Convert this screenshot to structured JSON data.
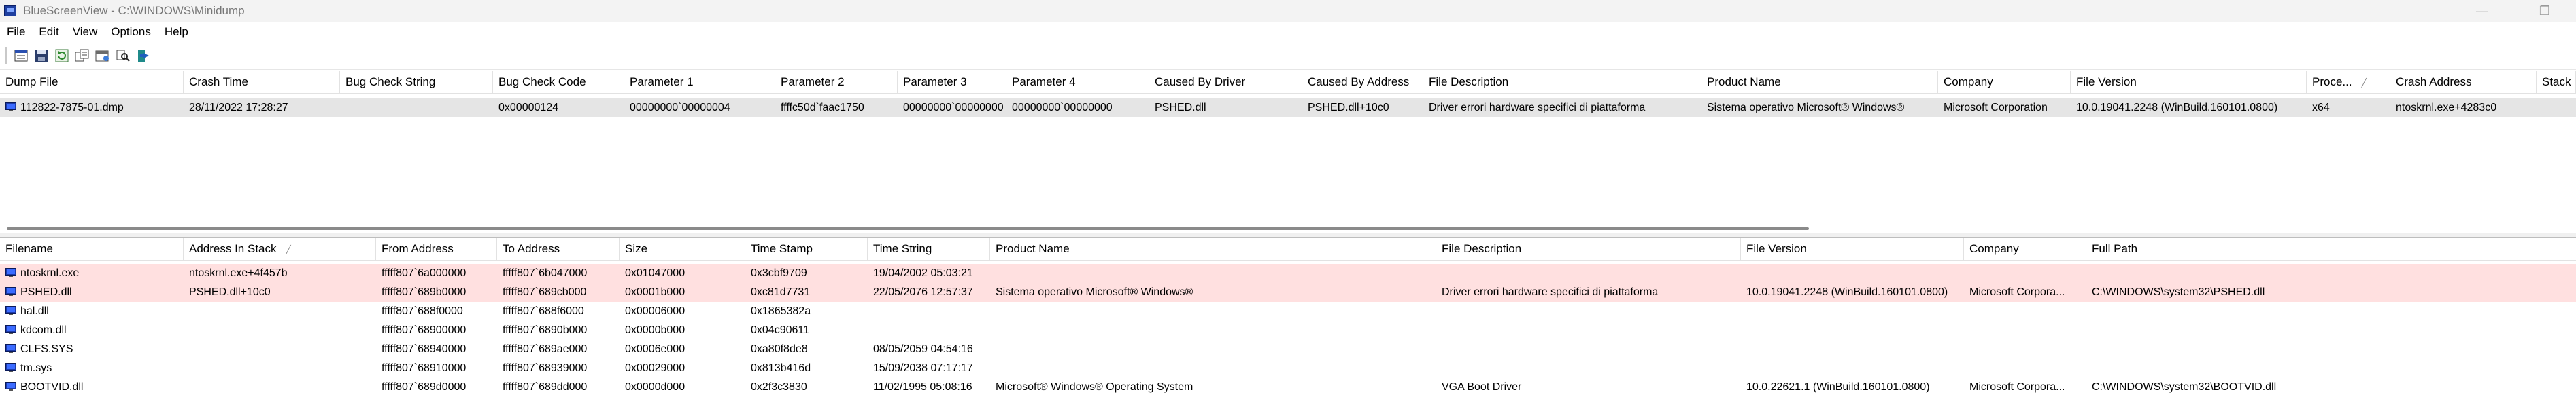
{
  "window": {
    "title": "BlueScreenView - C:\\WINDOWS\\Minidump",
    "controls": [
      "—",
      "❐"
    ]
  },
  "menu": [
    "File",
    "Edit",
    "View",
    "Options",
    "Help"
  ],
  "toolbar": {
    "icons": [
      "properties-icon",
      "save-icon",
      "refresh-icon",
      "copy-icon",
      "html-report-icon",
      "find-icon",
      "exit-icon"
    ]
  },
  "top_table": {
    "columns": [
      {
        "label": "Dump File"
      },
      {
        "label": "Crash Time"
      },
      {
        "label": "Bug Check String"
      },
      {
        "label": "Bug Check Code"
      },
      {
        "label": "Parameter 1"
      },
      {
        "label": "Parameter 2"
      },
      {
        "label": "Parameter 3"
      },
      {
        "label": "Parameter 4"
      },
      {
        "label": "Caused By Driver"
      },
      {
        "label": "Caused By Address"
      },
      {
        "label": "File Description"
      },
      {
        "label": "Product Name"
      },
      {
        "label": "Company"
      },
      {
        "label": "File Version"
      },
      {
        "label": "Proce...",
        "sorted": true
      },
      {
        "label": "Crash Address"
      },
      {
        "label": "Stack"
      }
    ],
    "rows": [
      {
        "cells": [
          "112822-7875-01.dmp",
          "28/11/2022 17:28:27",
          "",
          "0x00000124",
          "00000000`00000004",
          "ffffc50d`faac1750",
          "00000000`00000000",
          "00000000`00000000",
          "PSHED.dll",
          "PSHED.dll+10c0",
          "Driver errori hardware specifici di piattaforma",
          "Sistema operativo Microsoft® Windows®",
          "Microsoft Corporation",
          "10.0.19041.2248 (WinBuild.160101.0800)",
          "x64",
          "ntoskrnl.exe+4283c0",
          ""
        ]
      }
    ]
  },
  "bottom_table": {
    "columns": [
      {
        "label": "Filename"
      },
      {
        "label": "Address In Stack",
        "sorted": true
      },
      {
        "label": "From Address"
      },
      {
        "label": "To Address"
      },
      {
        "label": "Size"
      },
      {
        "label": "Time Stamp"
      },
      {
        "label": "Time String"
      },
      {
        "label": "Product Name"
      },
      {
        "label": "File Description"
      },
      {
        "label": "File Version"
      },
      {
        "label": "Company"
      },
      {
        "label": "Full Path"
      }
    ],
    "rows": [
      {
        "highlight": true,
        "cells": [
          "ntoskrnl.exe",
          "ntoskrnl.exe+4f457b",
          "fffff807`6a000000",
          "fffff807`6b047000",
          "0x01047000",
          "0x3cbf9709",
          "19/04/2002 05:03:21",
          "",
          "",
          "",
          "",
          ""
        ]
      },
      {
        "highlight": true,
        "cells": [
          "PSHED.dll",
          "PSHED.dll+10c0",
          "fffff807`689b0000",
          "fffff807`689cb000",
          "0x0001b000",
          "0xc81d7731",
          "22/05/2076 12:57:37",
          "Sistema operativo Microsoft® Windows®",
          "Driver errori hardware specifici di piattaforma",
          "10.0.19041.2248 (WinBuild.160101.0800)",
          "Microsoft Corpora...",
          "C:\\WINDOWS\\system32\\PSHED.dll"
        ]
      },
      {
        "highlight": false,
        "cells": [
          "hal.dll",
          "",
          "fffff807`688f0000",
          "fffff807`688f6000",
          "0x00006000",
          "0x1865382a",
          "",
          "",
          "",
          "",
          "",
          ""
        ]
      },
      {
        "highlight": false,
        "cells": [
          "kdcom.dll",
          "",
          "fffff807`68900000",
          "fffff807`6890b000",
          "0x0000b000",
          "0x04c90611",
          "",
          "",
          "",
          "",
          "",
          ""
        ]
      },
      {
        "highlight": false,
        "cells": [
          "CLFS.SYS",
          "",
          "fffff807`68940000",
          "fffff807`689ae000",
          "0x0006e000",
          "0xa80f8de8",
          "08/05/2059 04:54:16",
          "",
          "",
          "",
          "",
          ""
        ]
      },
      {
        "highlight": false,
        "cells": [
          "tm.sys",
          "",
          "fffff807`68910000",
          "fffff807`68939000",
          "0x00029000",
          "0x813b416d",
          "15/09/2038 07:17:17",
          "",
          "",
          "",
          "",
          ""
        ]
      },
      {
        "highlight": false,
        "cells": [
          "BOOTVID.dll",
          "",
          "fffff807`689d0000",
          "fffff807`689dd000",
          "0x0000d000",
          "0x2f3c3830",
          "11/02/1995 05:08:16",
          "Microsoft® Windows® Operating System",
          "VGA Boot Driver",
          "10.0.22621.1 (WinBuild.160101.0800)",
          "Microsoft Corpora...",
          "C:\\WINDOWS\\system32\\BOOTVID.dll"
        ]
      }
    ]
  },
  "colors": {
    "highlight_row": "#ffe0e0",
    "selected_row": "#e5e5e5",
    "text": "#000000"
  }
}
